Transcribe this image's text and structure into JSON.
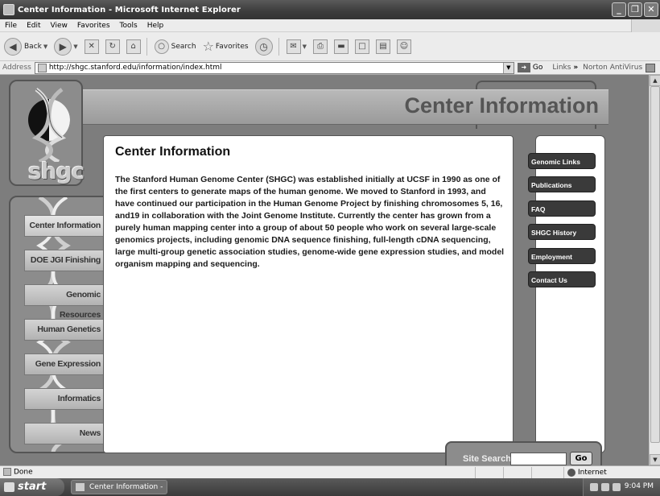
{
  "window": {
    "title": "Center Information - Microsoft Internet Explorer"
  },
  "menu": [
    "File",
    "Edit",
    "View",
    "Favorites",
    "Tools",
    "Help"
  ],
  "toolbar": {
    "back": "Back",
    "search": "Search",
    "favorites": "Favorites"
  },
  "address": {
    "label": "Address",
    "url": "http://shgc.stanford.edu/information/index.html",
    "go": "Go",
    "links": "Links",
    "links_chevron": "»",
    "norton": "Norton AntiVirus"
  },
  "page": {
    "logo_text": "shgc",
    "header_title": "Center Information",
    "content_title": "Center Information",
    "content_body": "The Stanford Human Genome Center (SHGC) was established initially at UCSF in 1990 as one of the first centers to generate maps of the human genome. We moved to Stanford in 1993, and have continued our participation in the Human Genome Project by finishing chromosomes 5, 16, and19 in collaboration with the Joint Genome Institute. Currently the center has grown from a purely human mapping center into a group of about 50 people who work on several large-scale genomics projects, including genomic DNA sequence finishing, full-length cDNA sequencing, large multi-group genetic association studies, genome-wide gene expression studies, and model organism mapping and sequencing.",
    "nav": [
      "Center Information",
      "DOE JGI Finishing",
      "Genomic Resources",
      "Human Genetics",
      "Gene Expression",
      "Informatics",
      "News"
    ],
    "right_links": [
      "Genomic Links",
      "Publications",
      "FAQ",
      "SHGC History",
      "Employment",
      "Contact Us"
    ],
    "search_label": "Site Search:",
    "search_button": "Go"
  },
  "status": {
    "text": "Done",
    "zone": "Internet"
  },
  "taskbar": {
    "start": "start",
    "task": "Center Information - ...",
    "clock": "9:04 PM"
  }
}
